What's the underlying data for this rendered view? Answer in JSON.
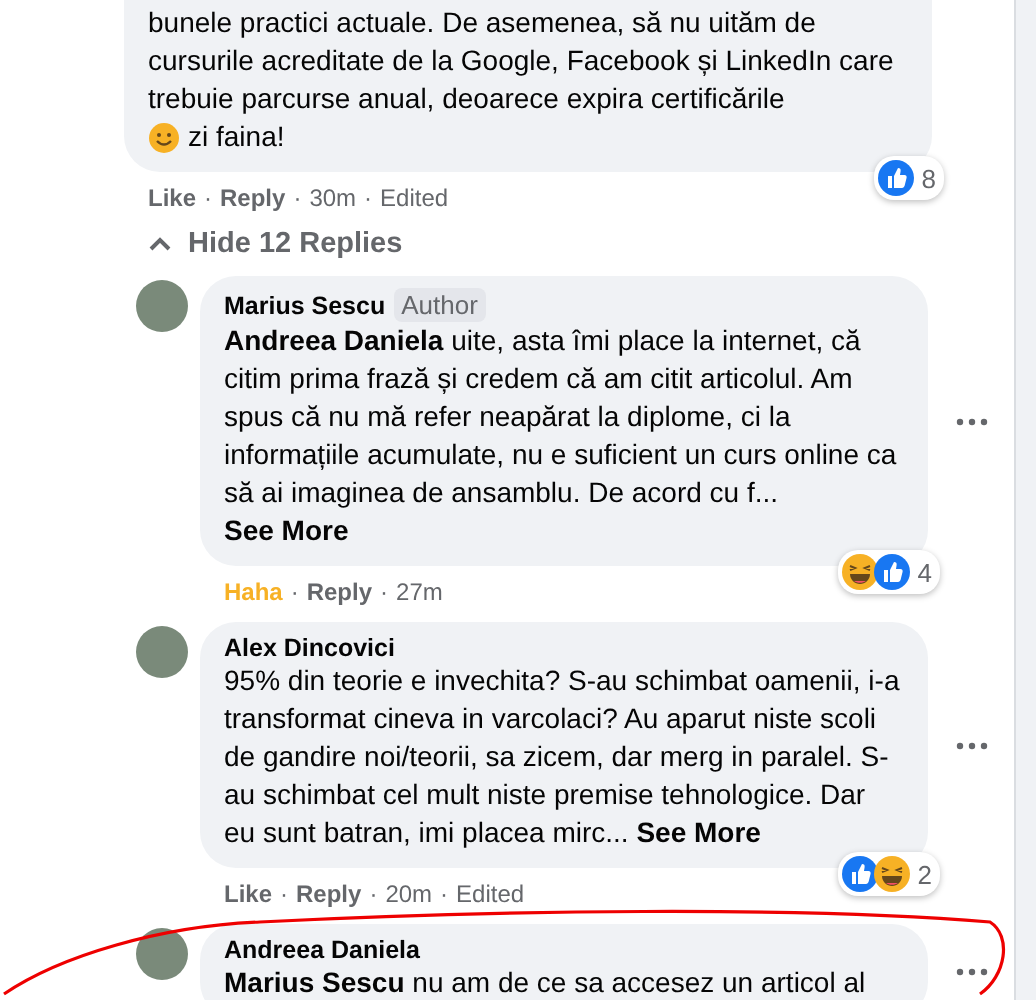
{
  "top_comment": {
    "text": "bunele practici actuale. De asemenea, să nu uităm de cursurile acreditate de la Google, Facebook și LinkedIn care trebuie parcurse anual, deoarece expira certificările",
    "emoji_text": "zi faina!",
    "reactions": {
      "icons": [
        {
          "kind": "like"
        }
      ],
      "count": "8"
    },
    "actions": {
      "reaction": {
        "label": "Like",
        "selected": false
      },
      "separator": "·",
      "reply": "Reply",
      "time": "30m",
      "edited": "Edited"
    }
  },
  "hide_replies": {
    "label": "Hide 12 Replies"
  },
  "replies": [
    {
      "author": "Marius Sescu",
      "badge": "Author",
      "mention": "Andreea Daniela",
      "text": "uite, asta îmi place la internet, că citim prima frază și credem că am citit articolul. Am spus că nu mă refer neapărat la diplome, ci la informațiile acumulate, nu e suficient un curs online ca să ai imaginea de ansamblu. De acord cu f...",
      "see_more": "See More",
      "reactions": {
        "icons": [
          {
            "kind": "haha"
          },
          {
            "kind": "like"
          }
        ],
        "count": "4"
      },
      "actions": {
        "reaction": {
          "label": "Haha",
          "selected": true
        },
        "separator": "·",
        "reply": "Reply",
        "time": "27m"
      }
    },
    {
      "author": "Alex Dincovici",
      "text": "95% din teorie e invechita? S-au schimbat oamenii, i-a transformat cineva in varcolaci? Au aparut niste scoli de gandire noi/teorii, sa zicem, dar merg in paralel. S-au schimbat cel mult niste premise tehnologice. Dar eu sunt batran, imi placea mirc...",
      "see_more": "See More",
      "reactions": {
        "icons": [
          {
            "kind": "like"
          },
          {
            "kind": "haha"
          }
        ],
        "count": "2"
      },
      "actions": {
        "reaction": {
          "label": "Like",
          "selected": false
        },
        "separator": "·",
        "reply": "Reply",
        "time": "20m",
        "edited": "Edited"
      }
    },
    {
      "author": "Andreea Daniela",
      "mention": "Marius Sescu",
      "text": "nu am de ce sa accesez un articol al"
    }
  ]
}
